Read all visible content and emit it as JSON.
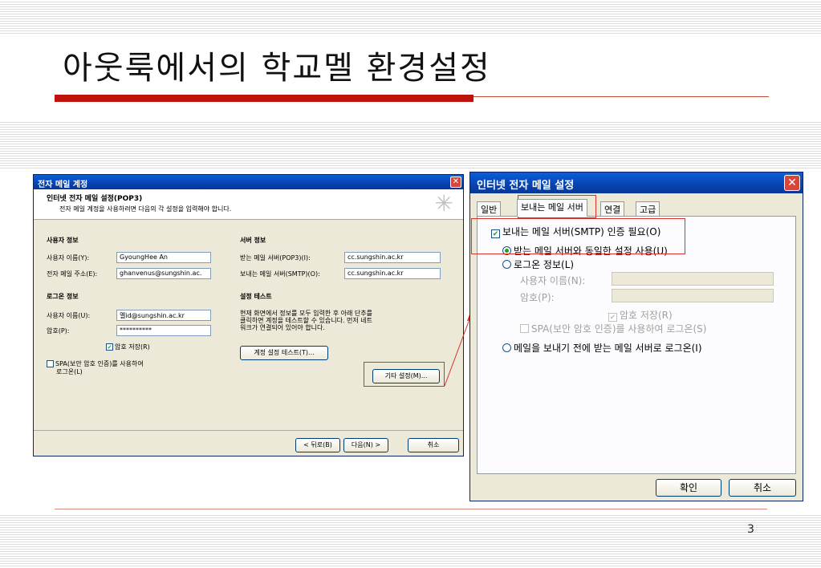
{
  "slide": {
    "title": "아웃룩에서의 학교멜 환경설정",
    "page_number": "3"
  },
  "dialog1": {
    "title": "전자 메일 계정",
    "header_title": "인터넷 전자 메일 설정(POP3)",
    "header_subtitle": "전자 메일 계정을 사용하려면 다음의 각 설정을 입력해야 합니다.",
    "user_info_heading": "사용자 정보",
    "name_label": "사용자 이름(Y):",
    "name_value": "GyoungHee An",
    "email_label": "전자 메일 주소(E):",
    "email_value": "ghanvenus@sungshin.ac.",
    "server_info_heading": "서버 정보",
    "incoming_label": "받는 메일 서버(POP3)(I):",
    "incoming_value": "cc.sungshin.ac.kr",
    "outgoing_label": "보내는 메일 서버(SMTP)(O):",
    "outgoing_value": "cc.sungshin.ac.kr",
    "logon_heading": "로그온 정보",
    "logon_user_label": "사용자 이름(U):",
    "logon_user_value": "멜id@sungshin.ac.kr",
    "password_label": "암호(P):",
    "password_value": "**********",
    "remember_password_label": "암호 저장(R)",
    "spa_label_line1": "SPA(보안 암호 인증)를 사용하여",
    "spa_label_line2": "로그온(L)",
    "test_heading": "설정 테스트",
    "test_text_line1": "현재 화면에서 정보를 모두 입력한 후 아래 단추를",
    "test_text_line2": "클릭하면 계정을 테스트할 수 있습니다. 먼저 네트",
    "test_text_line3": "워크가 연결되어 있어야 합니다.",
    "test_button": "계정 설정 테스트(T)...",
    "more_settings_button": "기타 설정(M)...",
    "back_button": "< 뒤로(B)",
    "next_button": "다음(N) >",
    "cancel_button": "취소"
  },
  "dialog2": {
    "title": "인터넷 전자 메일 설정",
    "tabs": [
      "일반",
      "보내는 메일 서버",
      "연결",
      "고급"
    ],
    "smtp_auth_label": "보내는 메일 서버(SMTP) 인증 필요(O)",
    "same_settings_label": "받는 메일 서버와 동일한 설정 사용(U)",
    "logon_info_label": "로그온 정보(L)",
    "username_label": "사용자 이름(N):",
    "password_label": "암호(P):",
    "remember_password_label": "암호 저장(R)",
    "spa_label": "SPA(보안 암호 인증)를 사용하여 로그온(S)",
    "logon_before_send_label": "메일을 보내기 전에 받는 메일 서버로 로그온(I)",
    "ok_button": "확인",
    "cancel_button": "취소"
  },
  "colors": {
    "accent_red": "#c0120c",
    "xp_title_blue": "#0842b0",
    "dialog_bg": "#ece9d8"
  }
}
